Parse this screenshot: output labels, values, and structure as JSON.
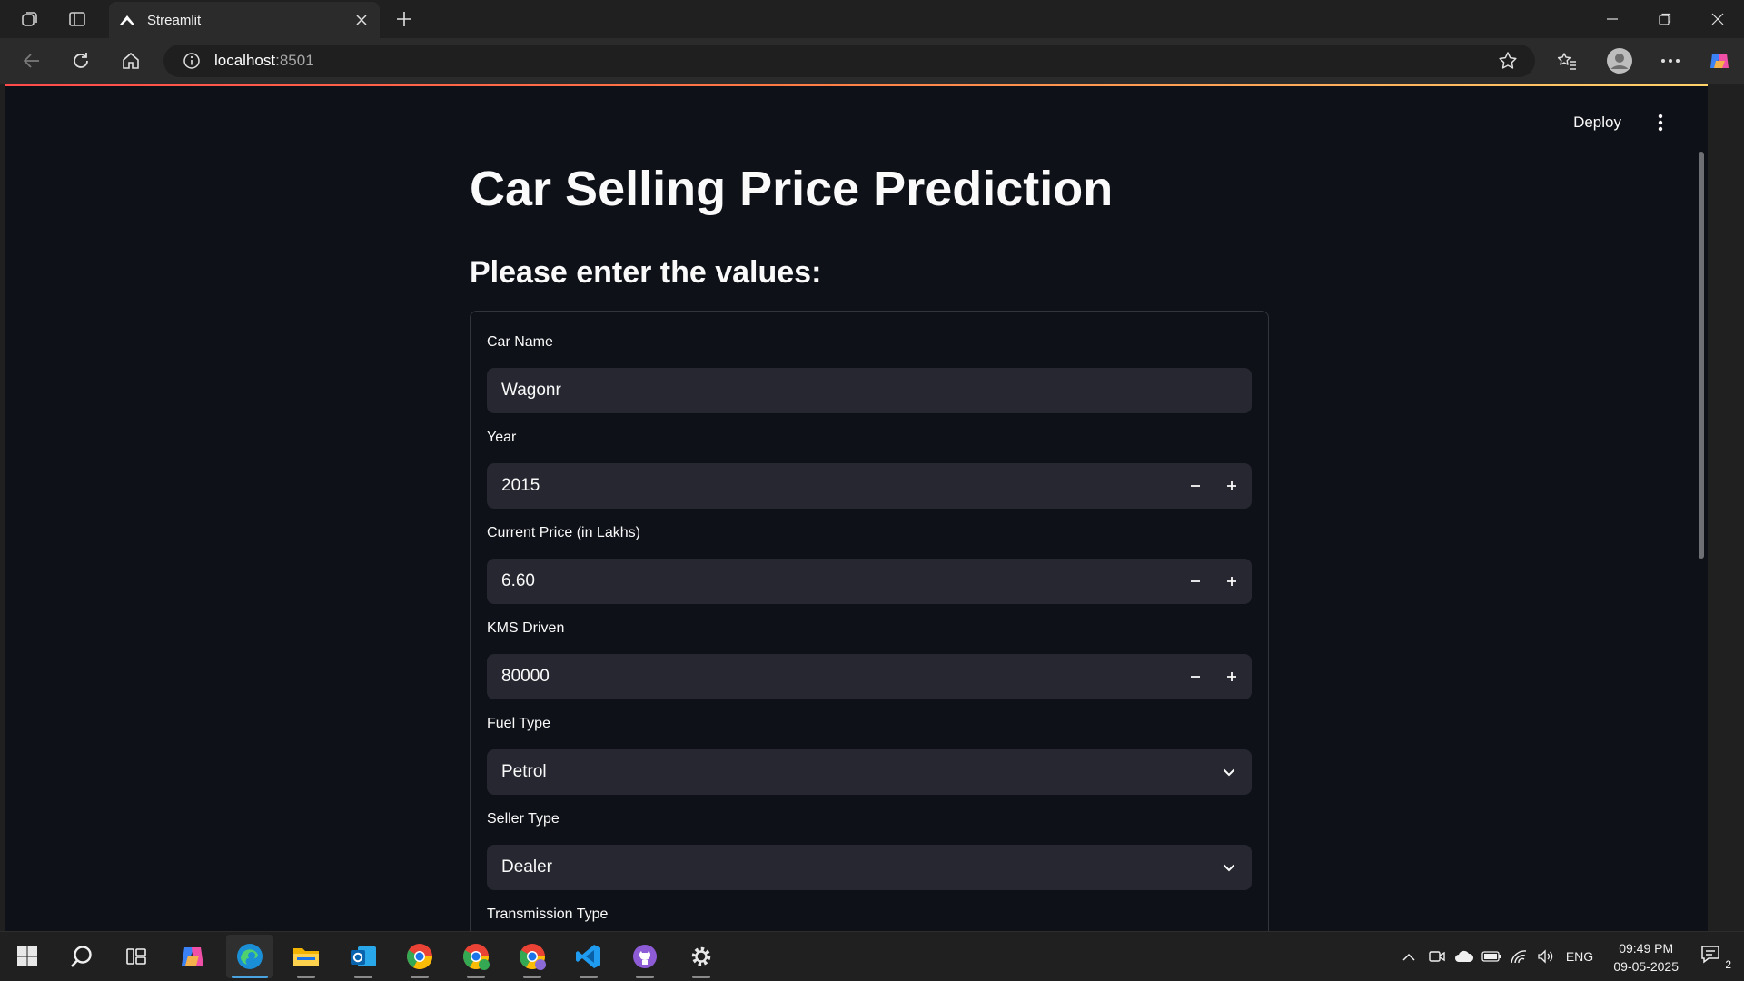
{
  "browser": {
    "tab_title": "Streamlit",
    "url_host": "localhost",
    "url_port": ":8501"
  },
  "app": {
    "deploy_label": "Deploy",
    "title": "Car Selling Price Prediction",
    "subtitle": "Please enter the values:",
    "accent_color": "#ff4b4b",
    "background_color": "#0e1117",
    "input_bg_color": "#262730",
    "fields": [
      {
        "label": "Car Name",
        "value": "Wagonr",
        "kind": "text"
      },
      {
        "label": "Year",
        "value": "2015",
        "kind": "number"
      },
      {
        "label": "Current Price (in Lakhs)",
        "value": "6.60",
        "kind": "number"
      },
      {
        "label": "KMS Driven",
        "value": "80000",
        "kind": "number"
      },
      {
        "label": "Fuel Type",
        "value": "Petrol",
        "kind": "select"
      },
      {
        "label": "Seller Type",
        "value": "Dealer",
        "kind": "select"
      },
      {
        "label": "Transmission Type",
        "value": "",
        "kind": "select"
      }
    ]
  },
  "taskbar": {
    "apps": [
      "start-icon",
      "search-icon",
      "task-view-icon",
      "copilot-icon",
      "edge-icon",
      "file-explorer-icon",
      "outlook-icon",
      "chrome-icon",
      "chrome-profile-g-icon",
      "chrome-profile-r-icon",
      "vscode-icon",
      "github-desktop-icon",
      "settings-icon"
    ],
    "language": "ENG",
    "time": "09:49 PM",
    "date": "09-05-2025",
    "notification_count": "2"
  }
}
